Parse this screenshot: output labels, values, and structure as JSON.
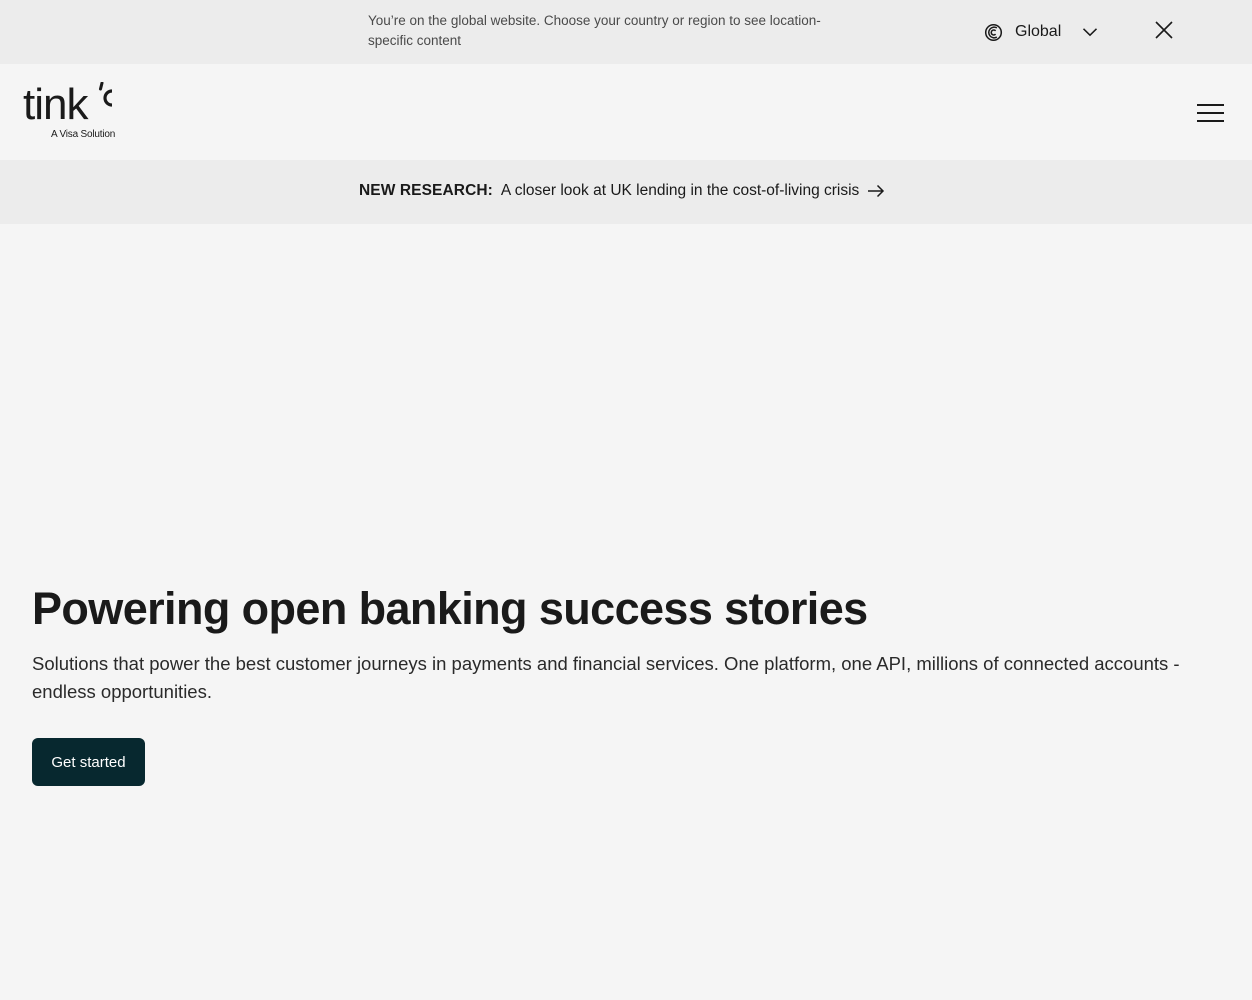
{
  "region_banner": {
    "message": "You’re on the global website. Choose your country or region to see location-specific content",
    "selected_region": "Global",
    "globe_icon": "globe-icon",
    "chevron_icon": "chevron-down-icon",
    "close_icon": "close-icon"
  },
  "header": {
    "logo_text": "tink",
    "logo_subtitle": "A Visa Solution",
    "menu_icon": "hamburger-menu-icon"
  },
  "announcement": {
    "label": "NEW RESEARCH:",
    "text": "A closer look at UK lending in the cost-of-living crisis",
    "arrow_icon": "arrow-right-icon"
  },
  "hero": {
    "title": "Powering open banking success stories",
    "subtitle": "Solutions that power the best customer journeys in payments and financial services. One platform, one API, millions of connected accounts - endless opportunities.",
    "cta_label": "Get started"
  },
  "colors": {
    "page_background": "#f5f5f5",
    "bar_background": "#ececec",
    "cta_background": "#07282f",
    "text": "#1a1a1a"
  }
}
